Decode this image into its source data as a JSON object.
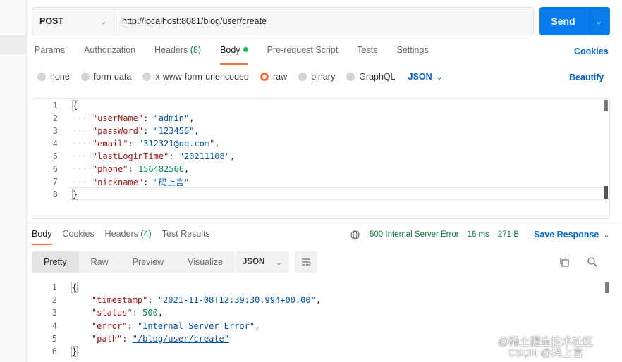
{
  "request": {
    "method": "POST",
    "url": "http://localhost:8081/blog/user/create",
    "send_label": "Send"
  },
  "request_tabs": [
    {
      "label": "Params"
    },
    {
      "label": "Authorization"
    },
    {
      "label": "Headers",
      "count": "(8)"
    },
    {
      "label": "Body",
      "active": true
    },
    {
      "label": "Pre-request Script"
    },
    {
      "label": "Tests"
    },
    {
      "label": "Settings"
    }
  ],
  "cookies_label": "Cookies",
  "body_types": [
    "none",
    "form-data",
    "x-www-form-urlencoded",
    "raw",
    "binary",
    "GraphQL"
  ],
  "body_type_selected": "raw",
  "body_format": "JSON",
  "beautify_label": "Beautify",
  "request_body": {
    "line_numbers": [
      "1",
      "2",
      "3",
      "4",
      "5",
      "6",
      "7",
      "8"
    ],
    "open_brace": "{",
    "close_brace": "}",
    "fields": [
      {
        "key": "\"userName\"",
        "value": "\"admin\"",
        "type": "string"
      },
      {
        "key": "\"passWord\"",
        "value": "\"123456\"",
        "type": "string"
      },
      {
        "key": "\"email\"",
        "value": "\"312321@qq.com\"",
        "type": "string"
      },
      {
        "key": "\"lastLoginTime\"",
        "value": "\"20211108\"",
        "type": "string"
      },
      {
        "key": "\"phone\"",
        "value": "156482566",
        "type": "number"
      },
      {
        "key": "\"nickname\"",
        "value": "\"码上言\"",
        "type": "string"
      }
    ]
  },
  "response_tabs": [
    {
      "label": "Body",
      "active": true
    },
    {
      "label": "Cookies"
    },
    {
      "label": "Headers",
      "count": "(4)"
    },
    {
      "label": "Test Results"
    }
  ],
  "response_status": {
    "status": "500 Internal Server Error",
    "time": "16 ms",
    "size": "271 B",
    "save_label": "Save Response"
  },
  "view_modes": [
    "Pretty",
    "Raw",
    "Preview",
    "Visualize"
  ],
  "view_mode_selected": "Pretty",
  "response_format": "JSON",
  "response_body": {
    "line_numbers": [
      "1",
      "2",
      "3",
      "4",
      "5",
      "6"
    ],
    "open_brace": "{",
    "close_brace": "}",
    "fields": [
      {
        "key": "\"timestamp\"",
        "value": "\"2021-11-08T12:39:30.994+00:00\"",
        "type": "string"
      },
      {
        "key": "\"status\"",
        "value": "500",
        "type": "number"
      },
      {
        "key": "\"error\"",
        "value": "\"Internal Server Error\"",
        "type": "string"
      },
      {
        "key": "\"path\"",
        "value": "\"/blog/user/create\"",
        "type": "link"
      }
    ]
  },
  "watermark": {
    "line1": "@稀土掘金技术社区",
    "line2": "CSDN @码上言"
  },
  "colors": {
    "accent": "#ff6c37",
    "link": "#0265d2",
    "send": "#097bed",
    "success_text": "#0a7a3a"
  }
}
